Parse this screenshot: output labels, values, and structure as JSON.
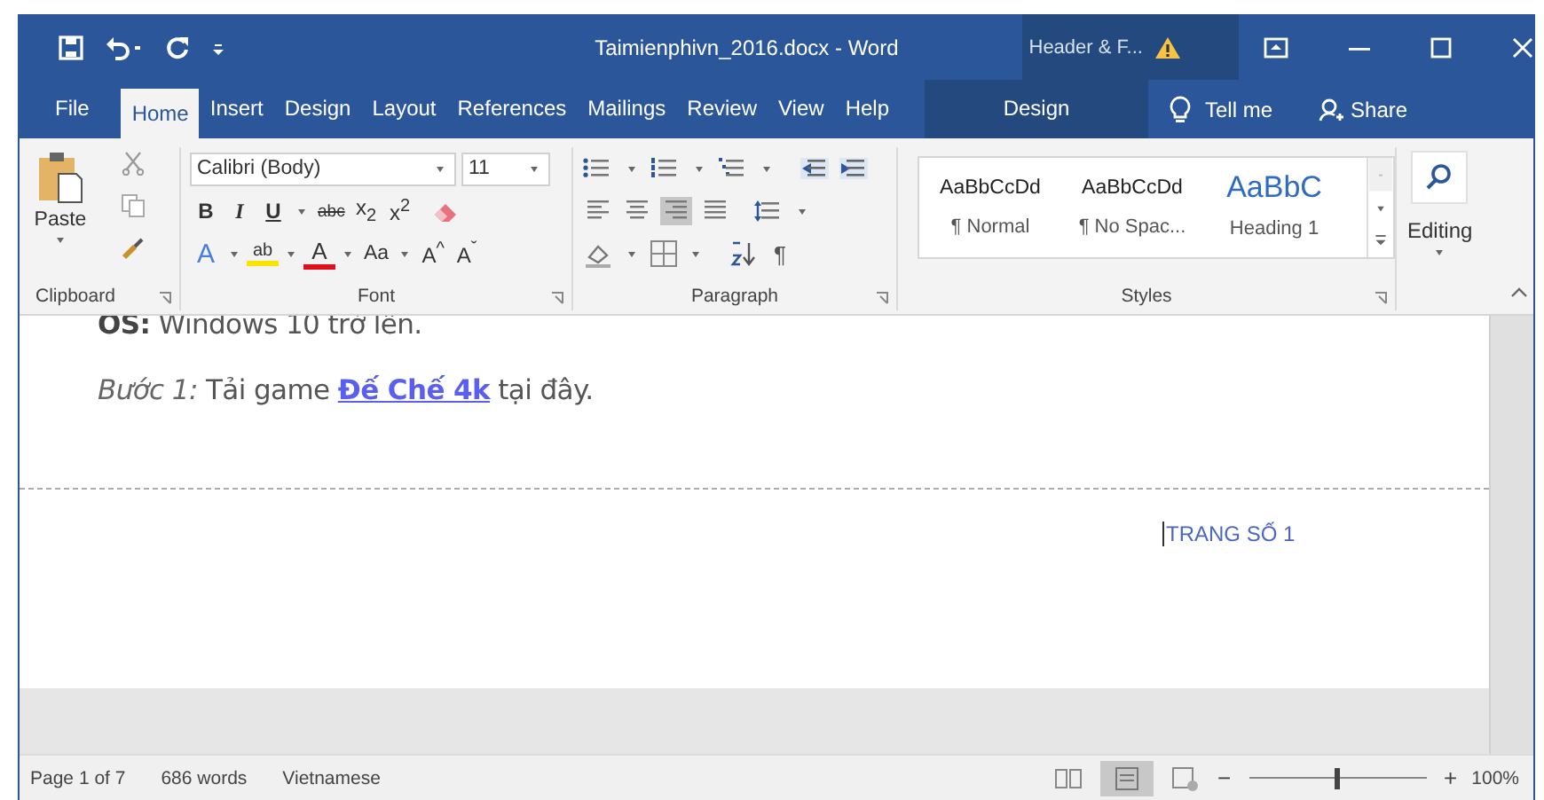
{
  "window": {
    "title": "Taimienphivn_2016.docx - Word",
    "context_title": "Header & F..."
  },
  "tabs": [
    {
      "label": "File",
      "selected": false,
      "kind": "normal"
    },
    {
      "label": "Home",
      "selected": true,
      "kind": "normal"
    },
    {
      "label": "Insert",
      "selected": false,
      "kind": "normal"
    },
    {
      "label": "Design",
      "selected": false,
      "kind": "normal"
    },
    {
      "label": "Layout",
      "selected": false,
      "kind": "normal"
    },
    {
      "label": "References",
      "selected": false,
      "kind": "normal"
    },
    {
      "label": "Mailings",
      "selected": false,
      "kind": "normal"
    },
    {
      "label": "Review",
      "selected": false,
      "kind": "normal"
    },
    {
      "label": "View",
      "selected": false,
      "kind": "normal"
    },
    {
      "label": "Help",
      "selected": false,
      "kind": "normal"
    },
    {
      "label": "Design",
      "selected": false,
      "kind": "contextual"
    }
  ],
  "tell_me": "Tell me",
  "share": "Share",
  "ribbon": {
    "clipboard": {
      "label": "Clipboard",
      "paste": "Paste"
    },
    "font": {
      "label": "Font",
      "font_name": "Calibri (Body)",
      "font_size": "11",
      "row1": [
        {
          "label": "B",
          "kind": "bold"
        },
        {
          "label": "I",
          "kind": "italic"
        },
        {
          "label": "U",
          "kind": "underline"
        },
        {
          "label": "abc",
          "kind": "strike"
        },
        {
          "label": "x$_{2}$",
          "kind": "plain"
        },
        {
          "label": "x$^{2}$",
          "kind": "plain"
        }
      ],
      "row2": [
        {
          "label": "A",
          "kind": "effects"
        },
        {
          "label": "ab",
          "kind": "highlight"
        },
        {
          "label": "A",
          "kind": "color"
        },
        {
          "label": "Aa",
          "kind": "case"
        },
        {
          "label": "A$^{^}$",
          "kind": "plain"
        },
        {
          "label": "A$^{ˇ}$",
          "kind": "plain"
        }
      ]
    },
    "paragraph": {
      "label": "Paragraph",
      "pilcrow": "¶"
    },
    "styles": {
      "label": "Styles",
      "items": [
        {
          "preview": "AaBbCcDd",
          "name": "¶ Normal",
          "kind": "body"
        },
        {
          "preview": "AaBbCcDd",
          "name": "¶ No Spac...",
          "kind": "body"
        },
        {
          "preview": "AaBbC",
          "name": "Heading 1",
          "kind": "heading"
        }
      ]
    },
    "editing": {
      "label": "Editing"
    }
  },
  "document": {
    "lines": [
      {
        "text": "**OS:** Windows 10 trở lên."
      },
      {
        "label": "Bước 1:",
        "before": " Tải game ",
        "link": "Đế Chế 4k",
        "after": " tại đây."
      }
    ],
    "header": "TRANG SỐ 1"
  },
  "status_bar": {
    "page": "Page 1 of 7",
    "words": "686 words",
    "language": "Vietnamese",
    "zoom_out": "−",
    "zoom_in": "+",
    "zoom": {
      "level": 0.5
    },
    "zoom_label": "100%"
  }
}
